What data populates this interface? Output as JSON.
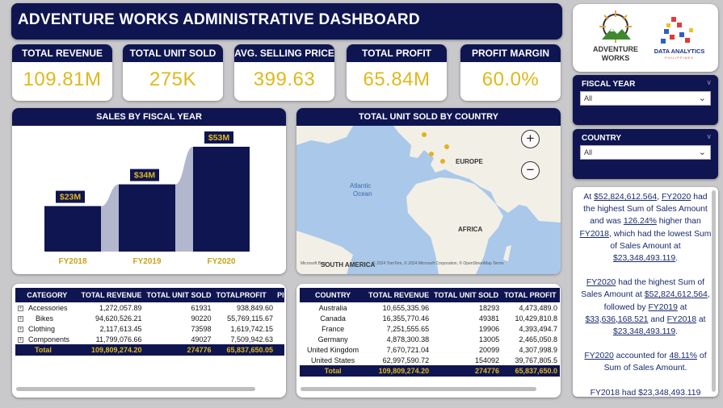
{
  "header": {
    "title": "ADVENTURE WORKS ADMINISTRATIVE  DASHBOARD"
  },
  "kpis": [
    {
      "label": "TOTAL REVENUE",
      "value": "109.81M"
    },
    {
      "label": "TOTAL UNIT SOLD",
      "value": "275K"
    },
    {
      "label": "AVG. SELLING PRICE",
      "value": "399.63"
    },
    {
      "label": "TOTAL PROFIT",
      "value": "65.84M"
    },
    {
      "label": "PROFIT MARGIN",
      "value": "60.0%"
    }
  ],
  "logos": {
    "adventure": {
      "line1": "ADVENTURE",
      "line2": "WORKS"
    },
    "dap": {
      "line1": "DATA ANALYTICS",
      "line2": "PHILIPPINES"
    }
  },
  "slicers": [
    {
      "label": "FISCAL YEAR",
      "value": "All"
    },
    {
      "label": "COUNTRY",
      "value": "All"
    }
  ],
  "bar_chart": {
    "title": "SALES BY FISCAL YEAR"
  },
  "chart_data": {
    "type": "bar",
    "categories": [
      "FY2018",
      "FY2019",
      "FY2020"
    ],
    "values": [
      23,
      34,
      53
    ],
    "data_labels": [
      "$23M",
      "$34M",
      "$53M"
    ],
    "ylim": [
      0,
      53
    ],
    "title": "SALES BY FISCAL YEAR",
    "bar_color": "#0e1550",
    "label_color": "#e0b81a",
    "ribbon_color": "#b3b7ce"
  },
  "map": {
    "title": "TOTAL UNIT SOLD BY COUNTRY",
    "labels": {
      "europe": "EUROPE",
      "atlantic1": "Atlantic",
      "atlantic2": "Ocean",
      "africa": "AFRICA",
      "south_america": "SOUTH AMERICA"
    },
    "attribution": "© 2024 TomTom, © 2024 Microsoft Corporation, © OpenStreetMap  Terms",
    "bing": "Microsoft Bing",
    "zoom_in": "+",
    "zoom_out": "−"
  },
  "category_table": {
    "headers": [
      "CATEGORY",
      "TOTAL REVENUE",
      "TOTAL UNIT SOLD",
      "TOTALPROFIT",
      "PI"
    ],
    "rows": [
      [
        "Accessories",
        "1,272,057.89",
        "61931",
        "938,849.60"
      ],
      [
        "Bikes",
        "94,620,526.21",
        "90220",
        "55,769,115.67"
      ],
      [
        "Clothing",
        "2,117,613.45",
        "73598",
        "1,619,742.15"
      ],
      [
        "Components",
        "11,799,076.66",
        "49027",
        "7,509,942.63"
      ]
    ],
    "total": [
      "Total",
      "109,809,274.20",
      "274776",
      "65,837,650.05"
    ]
  },
  "country_table": {
    "headers": [
      "COUNTRY",
      "TOTAL REVENUE",
      "TOTAL UNIT SOLD",
      "TOTAL PROFIT"
    ],
    "rows": [
      [
        "Australia",
        "10,655,335.96",
        "18293",
        "4,473,489.0"
      ],
      [
        "Canada",
        "16,355,770.46",
        "49381",
        "10,429,810.8"
      ],
      [
        "France",
        "7,251,555.65",
        "19906",
        "4,393,494.7"
      ],
      [
        "Germany",
        "4,878,300.38",
        "13005",
        "2,465,050.8"
      ],
      [
        "United Kingdom",
        "7,670,721.04",
        "20099",
        "4,307,998.9"
      ],
      [
        "United States",
        "62,997,590.72",
        "154092",
        "39,767,805.5"
      ]
    ],
    "total": [
      "Total",
      "109,809,274.20",
      "274776",
      "65,837,650.0"
    ]
  },
  "narrative": {
    "p1": {
      "a": "At ",
      "b": "$52,824,612.564",
      "c": ", ",
      "d": "FY2020",
      "e": " had the highest Sum of Sales Amount and was ",
      "f": "126.24%",
      "g": " higher than ",
      "h": "FY2018",
      "i": ", which had the lowest Sum of Sales Amount at ",
      "j": "$23,348,493.119",
      "k": "."
    },
    "p2": {
      "a": "FY2020",
      "b": " had the highest Sum of Sales Amount at ",
      "c": "$52,824,612.564",
      "d": ", followed by ",
      "e": "FY2019",
      "f": " at ",
      "g": "$33,636,168.521",
      "h": " and ",
      "i": "FY2018",
      "j": " at ",
      "k": "$23,348,493.119",
      "l": "."
    },
    "p3": {
      "a": "FY2020",
      "b": " accounted for ",
      "c": "48.11%",
      "d": " of Sum of Sales Amount."
    },
    "p4": {
      "a": "FY2018 had $23,348,493.119"
    }
  }
}
